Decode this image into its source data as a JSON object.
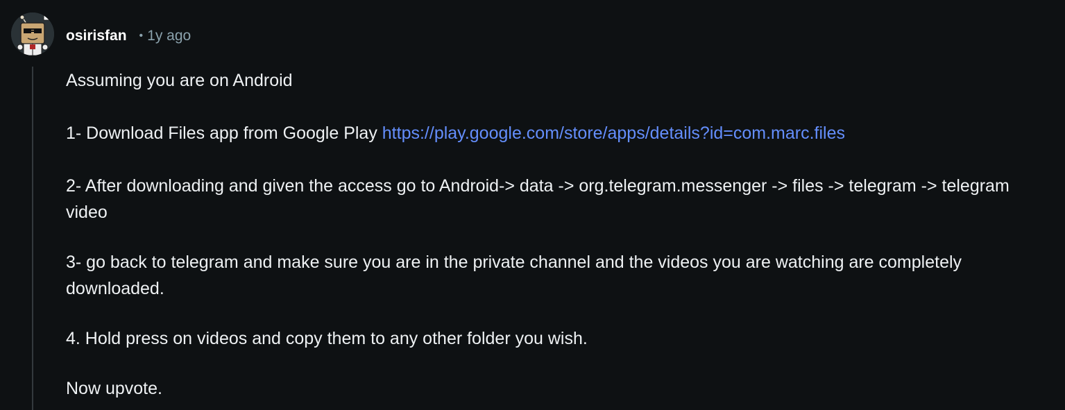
{
  "comment": {
    "author": "osirisfan",
    "separator": "•",
    "timestamp": "1y ago",
    "paragraphs": {
      "p1": "Assuming you are on Android",
      "p2_text": "1- Download Files app from Google Play ",
      "p2_link": "https://play.google.com/store/apps/details?id=com.marc.files",
      "p3": "2- After downloading and given the access go to Android-> data -> org.telegram.messenger -> files -> telegram -> telegram video",
      "p4": "3- go back to telegram and make sure you are in the private channel and the videos you are watching are completely downloaded.",
      "p5": "4. Hold press on videos and copy them to any other folder you wish.",
      "p6": "Now upvote."
    },
    "link_href": "https://play.google.com/store/apps/details?id=com.marc.files",
    "avatar_icon": "snoo-avatar-icon",
    "colors": {
      "background": "#0e1113",
      "text": "#eef1f3",
      "meta": "#8ba2ad",
      "link": "#648efc",
      "thread_line": "#33393d"
    }
  }
}
